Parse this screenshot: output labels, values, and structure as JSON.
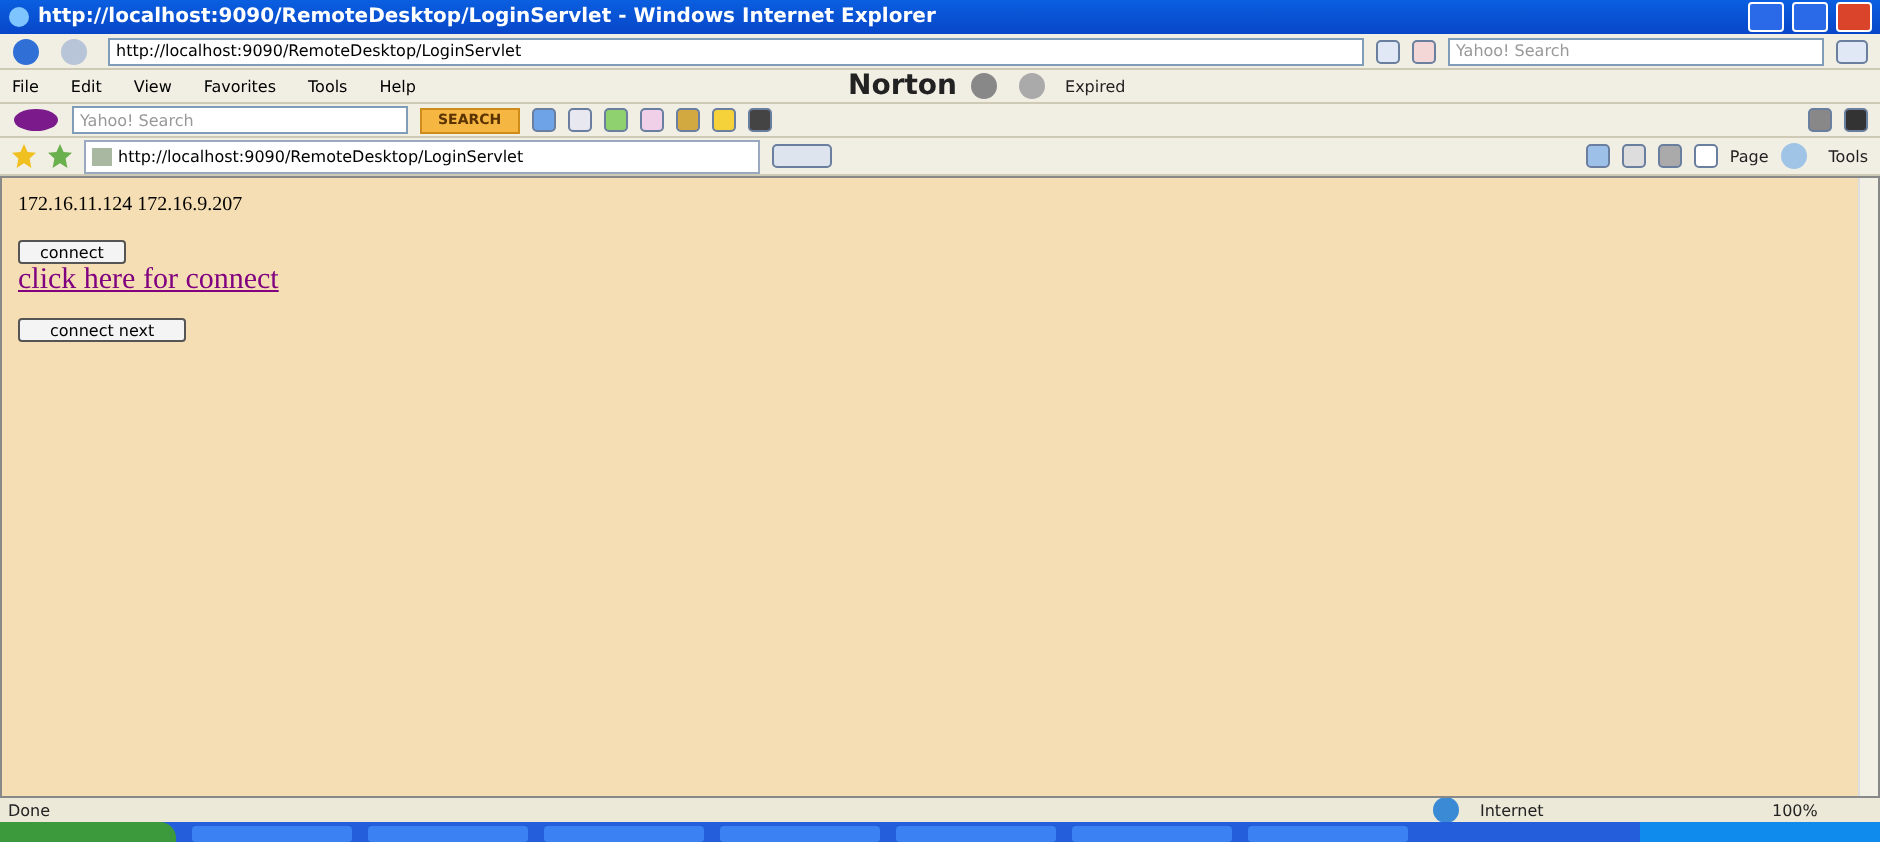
{
  "window": {
    "title": "http://localhost:9090/RemoteDesktop/LoginServlet - Windows Internet Explorer"
  },
  "address_bar": {
    "url": "http://localhost:9090/RemoteDesktop/LoginServlet",
    "search_placeholder": "Yahoo! Search"
  },
  "menu": [
    "File",
    "Edit",
    "View",
    "Favorites",
    "Tools",
    "Help"
  ],
  "norton": {
    "label": "Norton",
    "status": "Expired"
  },
  "yahoo_toolbar": {
    "placeholder": "Yahoo! Search",
    "button": "SEARCH"
  },
  "tabs": [
    {
      "label": "http://localhost:9090/RemoteDesktop/LoginServlet",
      "selected": true
    }
  ],
  "command_bar": [
    "Page",
    "Tools"
  ],
  "page": {
    "addresses": "172.16.11.124 172.16.9.207",
    "connect_button": "connect",
    "link": "click here for connect",
    "next_button": "connect next"
  },
  "status_bar": {
    "text": "Done",
    "zone": "Internet",
    "zoom": "100%"
  }
}
